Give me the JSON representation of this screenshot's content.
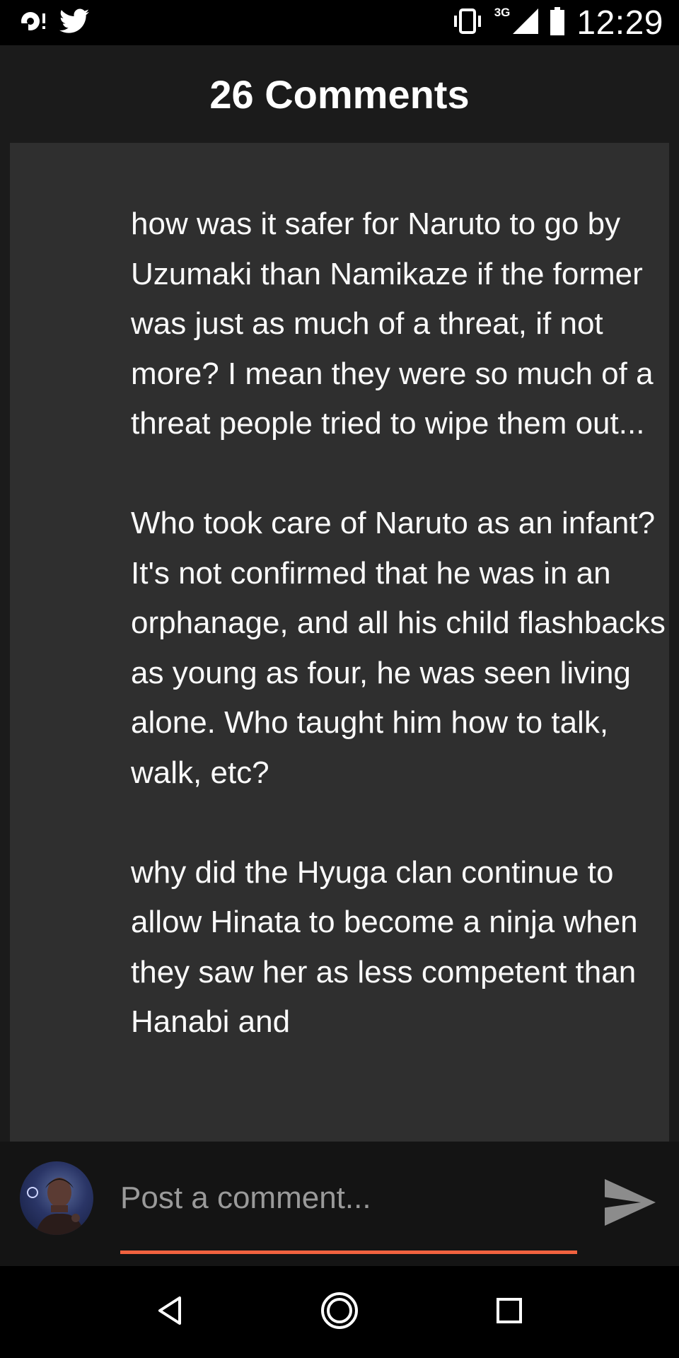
{
  "status_bar": {
    "time": "12:29",
    "network": "3G",
    "icons": [
      "notification-icon",
      "twitter-icon",
      "vibrate-icon",
      "signal-icon",
      "battery-icon"
    ]
  },
  "header": {
    "title": "26 Comments"
  },
  "comment": {
    "paragraphs": [
      "how was it safer for Naruto to go by Uzumaki than Namikaze if the former was just as much of a threat, if not more? I mean they were so much of a threat people tried to wipe them out...",
      "Who took care of Naruto as an infant? It's not confirmed that he was in an orphanage, and all his child flashbacks as young as four, he was seen living alone. Who taught him how to talk, walk, etc?",
      "why did the Hyuga clan continue to allow Hinata to become a ninja when they saw her as less competent than Hanabi and"
    ]
  },
  "comment_input": {
    "placeholder": "Post a comment...",
    "value": ""
  },
  "colors": {
    "accent": "#f0623f",
    "card_bg": "#2f2f2f",
    "header_bg": "#1b1b1b"
  },
  "nav": {
    "icons": [
      "back-icon",
      "home-icon",
      "recents-icon"
    ]
  }
}
